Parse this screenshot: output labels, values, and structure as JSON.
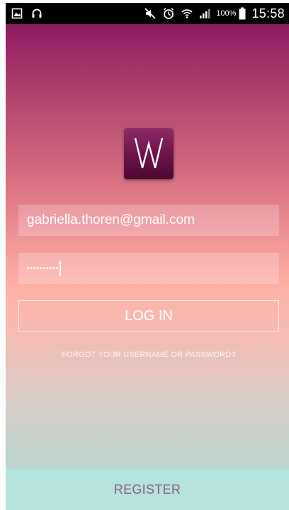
{
  "status_bar": {
    "icons": [
      "image-notification-icon",
      "headset-icon",
      "mute-icon",
      "alarm-icon",
      "wifi-icon",
      "signal-icon",
      "battery-icon"
    ],
    "battery_percent": "100%",
    "time": "15:58"
  },
  "logo": {
    "letter": "W",
    "colors": {
      "top": "#8e2b67",
      "bottom": "#4d0833",
      "stroke": "#ffffff"
    }
  },
  "login_form": {
    "email_value": "gabriella.thoren@gmail.com",
    "password_value": "••••••••••",
    "login_label": "LOG IN",
    "forgot_label": "FORGOT YOUR USERNAME OR PASSWORD?"
  },
  "footer": {
    "register_label": "REGISTER"
  },
  "colors": {
    "gradient_top": "#8c1a5f",
    "gradient_mid": "#ffb3a7",
    "gradient_bottom": "#b3dcd6",
    "register_bar": "#b5e3dd",
    "register_text": "#8a5a7e"
  }
}
